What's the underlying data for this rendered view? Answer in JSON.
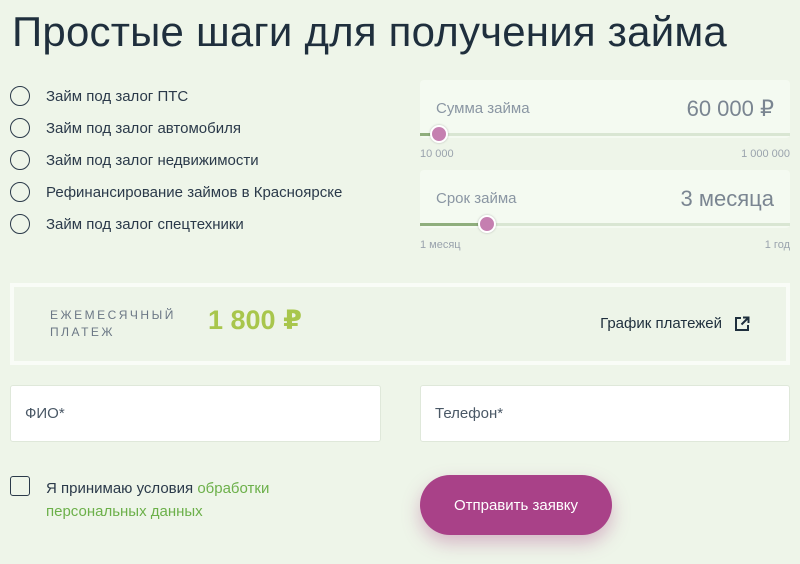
{
  "title": "Простые шаги для получения займа",
  "loan_types": [
    {
      "label": "Займ под залог ПТС"
    },
    {
      "label": "Займ под залог автомобиля"
    },
    {
      "label": "Займ под залог недвижимости"
    },
    {
      "label": "Рефинансирование займов в Красноярске"
    },
    {
      "label": "Займ под залог спецтехники"
    }
  ],
  "amount": {
    "label": "Сумма займа",
    "value": "60 000 ₽",
    "min_label": "10 000",
    "max_label": "1 000 000",
    "slider_fraction": 0.05
  },
  "term": {
    "label": "Срок займа",
    "value": "3 месяца",
    "min_label": "1 месяц",
    "max_label": "1 год",
    "slider_fraction": 0.18
  },
  "payment": {
    "caption_line1": "ЕЖЕМЕСЯЧНЫЙ",
    "caption_line2": "ПЛАТЕЖ",
    "amount": "1 800 ₽",
    "schedule_link": "График платежей"
  },
  "form": {
    "name_placeholder": "ФИО*",
    "phone_placeholder": "Телефон*",
    "consent_text": "Я принимаю условия ",
    "consent_link_line1": "обработки",
    "consent_link_line2": "персональных данных",
    "submit_label": "Отправить заявку"
  },
  "icons": {
    "schedule": "external-link-icon"
  },
  "colors": {
    "background": "#eef5e9",
    "accent_green": "#a8c64c",
    "link_green": "#6cb04a",
    "button": "#a94188",
    "slider_thumb": "#c57fb0"
  }
}
